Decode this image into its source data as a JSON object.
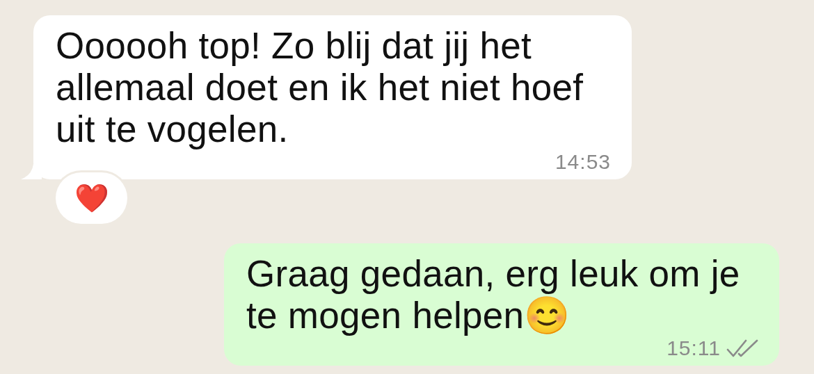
{
  "messages": [
    {
      "kind": "incoming",
      "text": "Oooooh top! Zo blij dat jij het allemaal doet en ik het niet hoef uit te vogelen.",
      "time": "14:53",
      "reactions": [
        "❤️"
      ]
    },
    {
      "kind": "outgoing",
      "text": "Graag gedaan, erg leuk om je te mogen helpen😊",
      "time": "15:11",
      "read": false
    }
  ]
}
